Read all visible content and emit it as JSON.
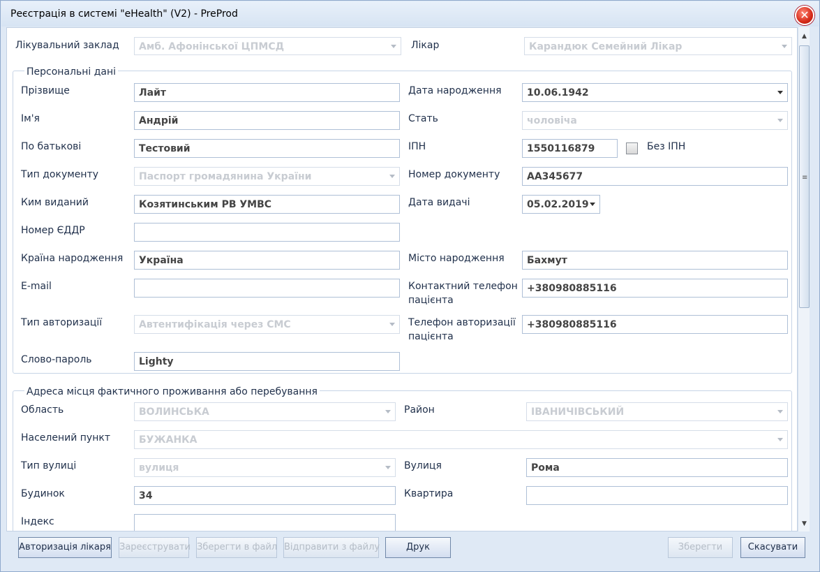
{
  "window": {
    "title": "Реєстрація в системі \"eHealth\" (V2) - PreProd"
  },
  "top": {
    "clinic_label": "Лікувальний заклад",
    "clinic_value": "Амб. Афонінської ЦПМСД",
    "doctor_label": "Лікар",
    "doctor_value": "Карандюк Семейний Лікар"
  },
  "personal": {
    "title": "Персональні дані",
    "surname_label": "Прізвище",
    "surname": "Лайт",
    "name_label": "Ім'я",
    "name": "Андрій",
    "patronymic_label": "По батькові",
    "patronymic": "Тестовий",
    "doc_type_label": "Тип документу",
    "doc_type": "Паспорт громадянина України",
    "issued_by_label": "Ким виданий",
    "issued_by": "Козятинським РВ УМВС",
    "eddr_label": "Номер ЄДДР",
    "eddr": "",
    "birth_country_label": "Країна народження",
    "birth_country": "Україна",
    "email_label": "E-mail",
    "email": "",
    "auth_type_label": "Тип авторизації",
    "auth_type": "Автентифікація через СМС",
    "password_label": "Слово-пароль",
    "password": "Lighty",
    "birth_date_label": "Дата народження",
    "birth_date": "10.06.1942",
    "sex_label": "Стать",
    "sex": "чоловіча",
    "ipn_label": "ІПН",
    "ipn": "1550116879",
    "no_ipn_label": "Без ІПН",
    "no_ipn_checked": false,
    "doc_number_label": "Номер документу",
    "doc_number": "АА345677",
    "issue_date_label": "Дата видачі",
    "issue_date": "05.02.2019",
    "birth_city_label": "Місто народження",
    "birth_city": "Бахмут",
    "phone_label_1": "Контактний телефон",
    "phone_label_2": "пацієнта",
    "phone": "+380980885116",
    "auth_phone_label_1": "Телефон авторизації",
    "auth_phone_label_2": "пацієнта",
    "auth_phone": "+380980885116"
  },
  "address": {
    "title": "Адреса місця фактичного проживання або перебування",
    "region_label": "Область",
    "region": "ВОЛИНСЬКА",
    "district_label": "Район",
    "district": "ІВАНИЧІВСЬКИЙ",
    "locality_label": "Населений пункт",
    "locality": "БУЖАНКА",
    "street_type_label": "Тип вулиці",
    "street_type": "вулиця",
    "street_label": "Вулиця",
    "street": "Рома",
    "house_label": "Будинок",
    "house": "34",
    "apartment_label": "Квартира",
    "apartment": "",
    "index_label": "Індекс",
    "index": ""
  },
  "buttons": {
    "auth_doctor": "Авторизація лікаря",
    "register": "Зареєструвати",
    "save_file": "Зберегти в файл",
    "send_file": "Відправити з файлу",
    "print": "Друк",
    "save": "Зберегти",
    "cancel": "Скасувати"
  },
  "icons": {
    "close": "close-icon",
    "scroll_up": "arrow-up-icon",
    "scroll_down": "arrow-down-icon",
    "dropdown": "chevron-down-icon"
  }
}
